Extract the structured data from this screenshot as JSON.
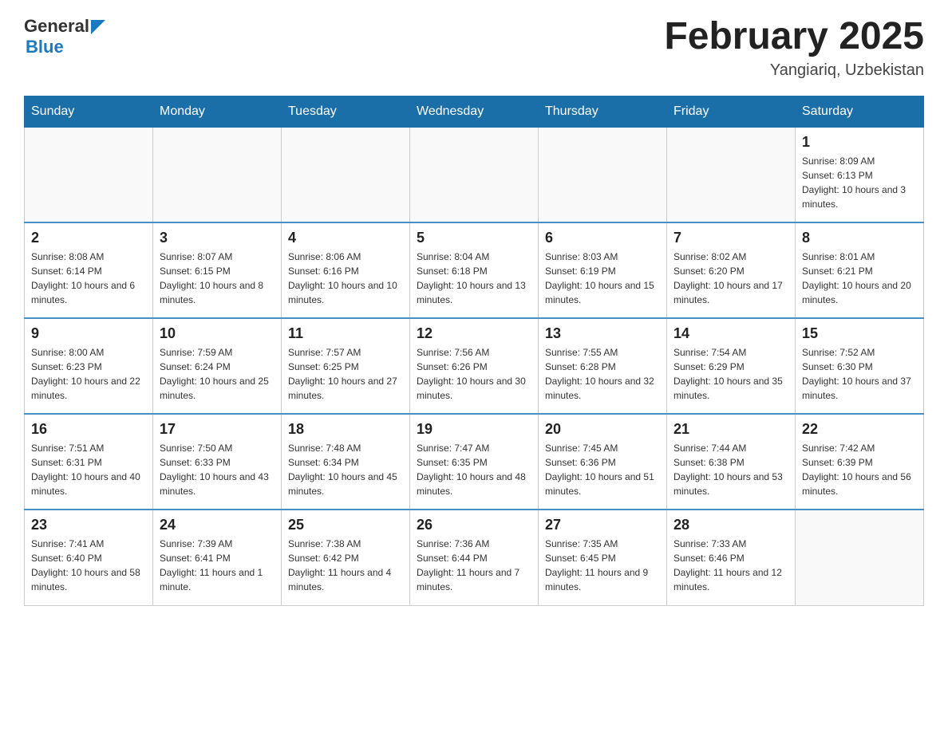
{
  "header": {
    "logo_text_general": "General",
    "logo_text_blue": "Blue",
    "month_title": "February 2025",
    "location": "Yangiariq, Uzbekistan"
  },
  "weekdays": [
    "Sunday",
    "Monday",
    "Tuesday",
    "Wednesday",
    "Thursday",
    "Friday",
    "Saturday"
  ],
  "weeks": [
    [
      {
        "day": "",
        "info": ""
      },
      {
        "day": "",
        "info": ""
      },
      {
        "day": "",
        "info": ""
      },
      {
        "day": "",
        "info": ""
      },
      {
        "day": "",
        "info": ""
      },
      {
        "day": "",
        "info": ""
      },
      {
        "day": "1",
        "info": "Sunrise: 8:09 AM\nSunset: 6:13 PM\nDaylight: 10 hours and 3 minutes."
      }
    ],
    [
      {
        "day": "2",
        "info": "Sunrise: 8:08 AM\nSunset: 6:14 PM\nDaylight: 10 hours and 6 minutes."
      },
      {
        "day": "3",
        "info": "Sunrise: 8:07 AM\nSunset: 6:15 PM\nDaylight: 10 hours and 8 minutes."
      },
      {
        "day": "4",
        "info": "Sunrise: 8:06 AM\nSunset: 6:16 PM\nDaylight: 10 hours and 10 minutes."
      },
      {
        "day": "5",
        "info": "Sunrise: 8:04 AM\nSunset: 6:18 PM\nDaylight: 10 hours and 13 minutes."
      },
      {
        "day": "6",
        "info": "Sunrise: 8:03 AM\nSunset: 6:19 PM\nDaylight: 10 hours and 15 minutes."
      },
      {
        "day": "7",
        "info": "Sunrise: 8:02 AM\nSunset: 6:20 PM\nDaylight: 10 hours and 17 minutes."
      },
      {
        "day": "8",
        "info": "Sunrise: 8:01 AM\nSunset: 6:21 PM\nDaylight: 10 hours and 20 minutes."
      }
    ],
    [
      {
        "day": "9",
        "info": "Sunrise: 8:00 AM\nSunset: 6:23 PM\nDaylight: 10 hours and 22 minutes."
      },
      {
        "day": "10",
        "info": "Sunrise: 7:59 AM\nSunset: 6:24 PM\nDaylight: 10 hours and 25 minutes."
      },
      {
        "day": "11",
        "info": "Sunrise: 7:57 AM\nSunset: 6:25 PM\nDaylight: 10 hours and 27 minutes."
      },
      {
        "day": "12",
        "info": "Sunrise: 7:56 AM\nSunset: 6:26 PM\nDaylight: 10 hours and 30 minutes."
      },
      {
        "day": "13",
        "info": "Sunrise: 7:55 AM\nSunset: 6:28 PM\nDaylight: 10 hours and 32 minutes."
      },
      {
        "day": "14",
        "info": "Sunrise: 7:54 AM\nSunset: 6:29 PM\nDaylight: 10 hours and 35 minutes."
      },
      {
        "day": "15",
        "info": "Sunrise: 7:52 AM\nSunset: 6:30 PM\nDaylight: 10 hours and 37 minutes."
      }
    ],
    [
      {
        "day": "16",
        "info": "Sunrise: 7:51 AM\nSunset: 6:31 PM\nDaylight: 10 hours and 40 minutes."
      },
      {
        "day": "17",
        "info": "Sunrise: 7:50 AM\nSunset: 6:33 PM\nDaylight: 10 hours and 43 minutes."
      },
      {
        "day": "18",
        "info": "Sunrise: 7:48 AM\nSunset: 6:34 PM\nDaylight: 10 hours and 45 minutes."
      },
      {
        "day": "19",
        "info": "Sunrise: 7:47 AM\nSunset: 6:35 PM\nDaylight: 10 hours and 48 minutes."
      },
      {
        "day": "20",
        "info": "Sunrise: 7:45 AM\nSunset: 6:36 PM\nDaylight: 10 hours and 51 minutes."
      },
      {
        "day": "21",
        "info": "Sunrise: 7:44 AM\nSunset: 6:38 PM\nDaylight: 10 hours and 53 minutes."
      },
      {
        "day": "22",
        "info": "Sunrise: 7:42 AM\nSunset: 6:39 PM\nDaylight: 10 hours and 56 minutes."
      }
    ],
    [
      {
        "day": "23",
        "info": "Sunrise: 7:41 AM\nSunset: 6:40 PM\nDaylight: 10 hours and 58 minutes."
      },
      {
        "day": "24",
        "info": "Sunrise: 7:39 AM\nSunset: 6:41 PM\nDaylight: 11 hours and 1 minute."
      },
      {
        "day": "25",
        "info": "Sunrise: 7:38 AM\nSunset: 6:42 PM\nDaylight: 11 hours and 4 minutes."
      },
      {
        "day": "26",
        "info": "Sunrise: 7:36 AM\nSunset: 6:44 PM\nDaylight: 11 hours and 7 minutes."
      },
      {
        "day": "27",
        "info": "Sunrise: 7:35 AM\nSunset: 6:45 PM\nDaylight: 11 hours and 9 minutes."
      },
      {
        "day": "28",
        "info": "Sunrise: 7:33 AM\nSunset: 6:46 PM\nDaylight: 11 hours and 12 minutes."
      },
      {
        "day": "",
        "info": ""
      }
    ]
  ]
}
